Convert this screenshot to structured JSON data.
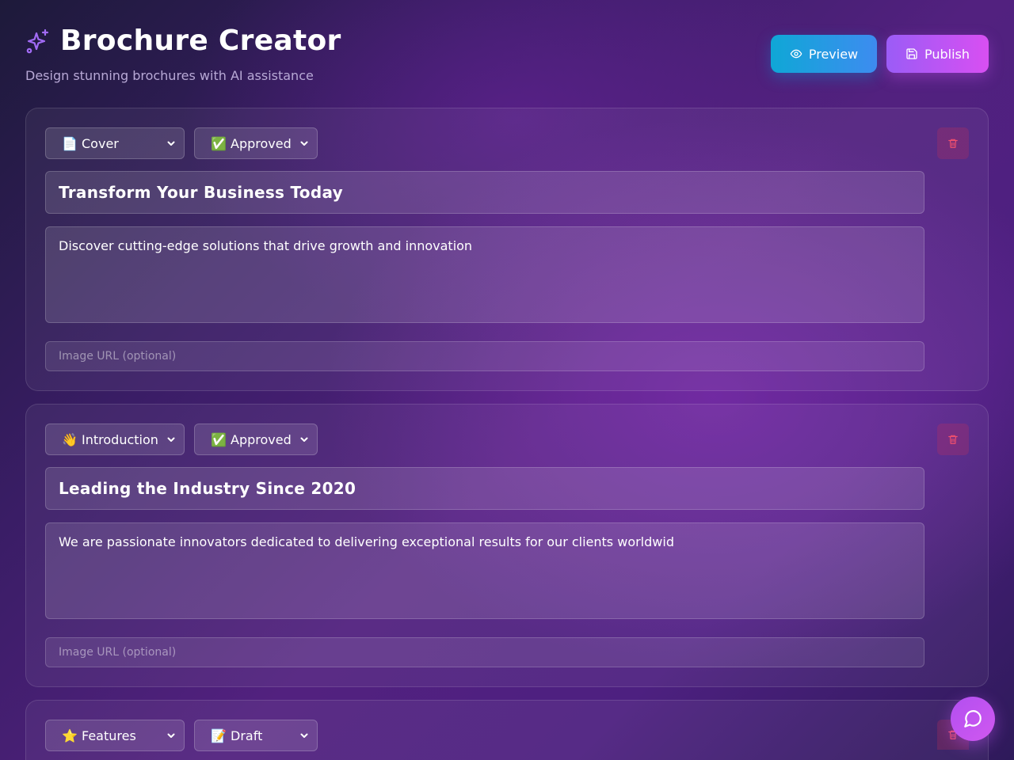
{
  "header": {
    "title": "Brochure Creator",
    "subtitle": "Design stunning brochures with AI assistance",
    "preview_label": "Preview",
    "publish_label": "Publish"
  },
  "sections": [
    {
      "type": "📄 Cover",
      "status": "✅ Approved",
      "heading": "Transform Your Business Today",
      "body": "Discover cutting-edge solutions that drive growth and innovation",
      "image_placeholder": "Image URL (optional)"
    },
    {
      "type": "👋 Introduction",
      "status": "✅ Approved",
      "heading": "Leading the Industry Since 2020",
      "body": "We are passionate innovators dedicated to delivering exceptional results for our clients worldwid",
      "image_placeholder": "Image URL (optional)"
    },
    {
      "type": "⭐ Features",
      "status": "📝 Draft",
      "heading": "",
      "body": "",
      "image_placeholder": ""
    }
  ],
  "icons": {
    "title": "sparkles-icon",
    "preview": "eye-icon",
    "publish": "save-icon",
    "delete": "trash-icon",
    "select": "chevron-down-icon",
    "chat": "chat-bubble-icon"
  },
  "colors": {
    "accent_purple": "#9b5cf6",
    "accent_pink": "#d84ff2",
    "accent_cyan": "#0fa7d6",
    "danger": "#f0506e"
  }
}
